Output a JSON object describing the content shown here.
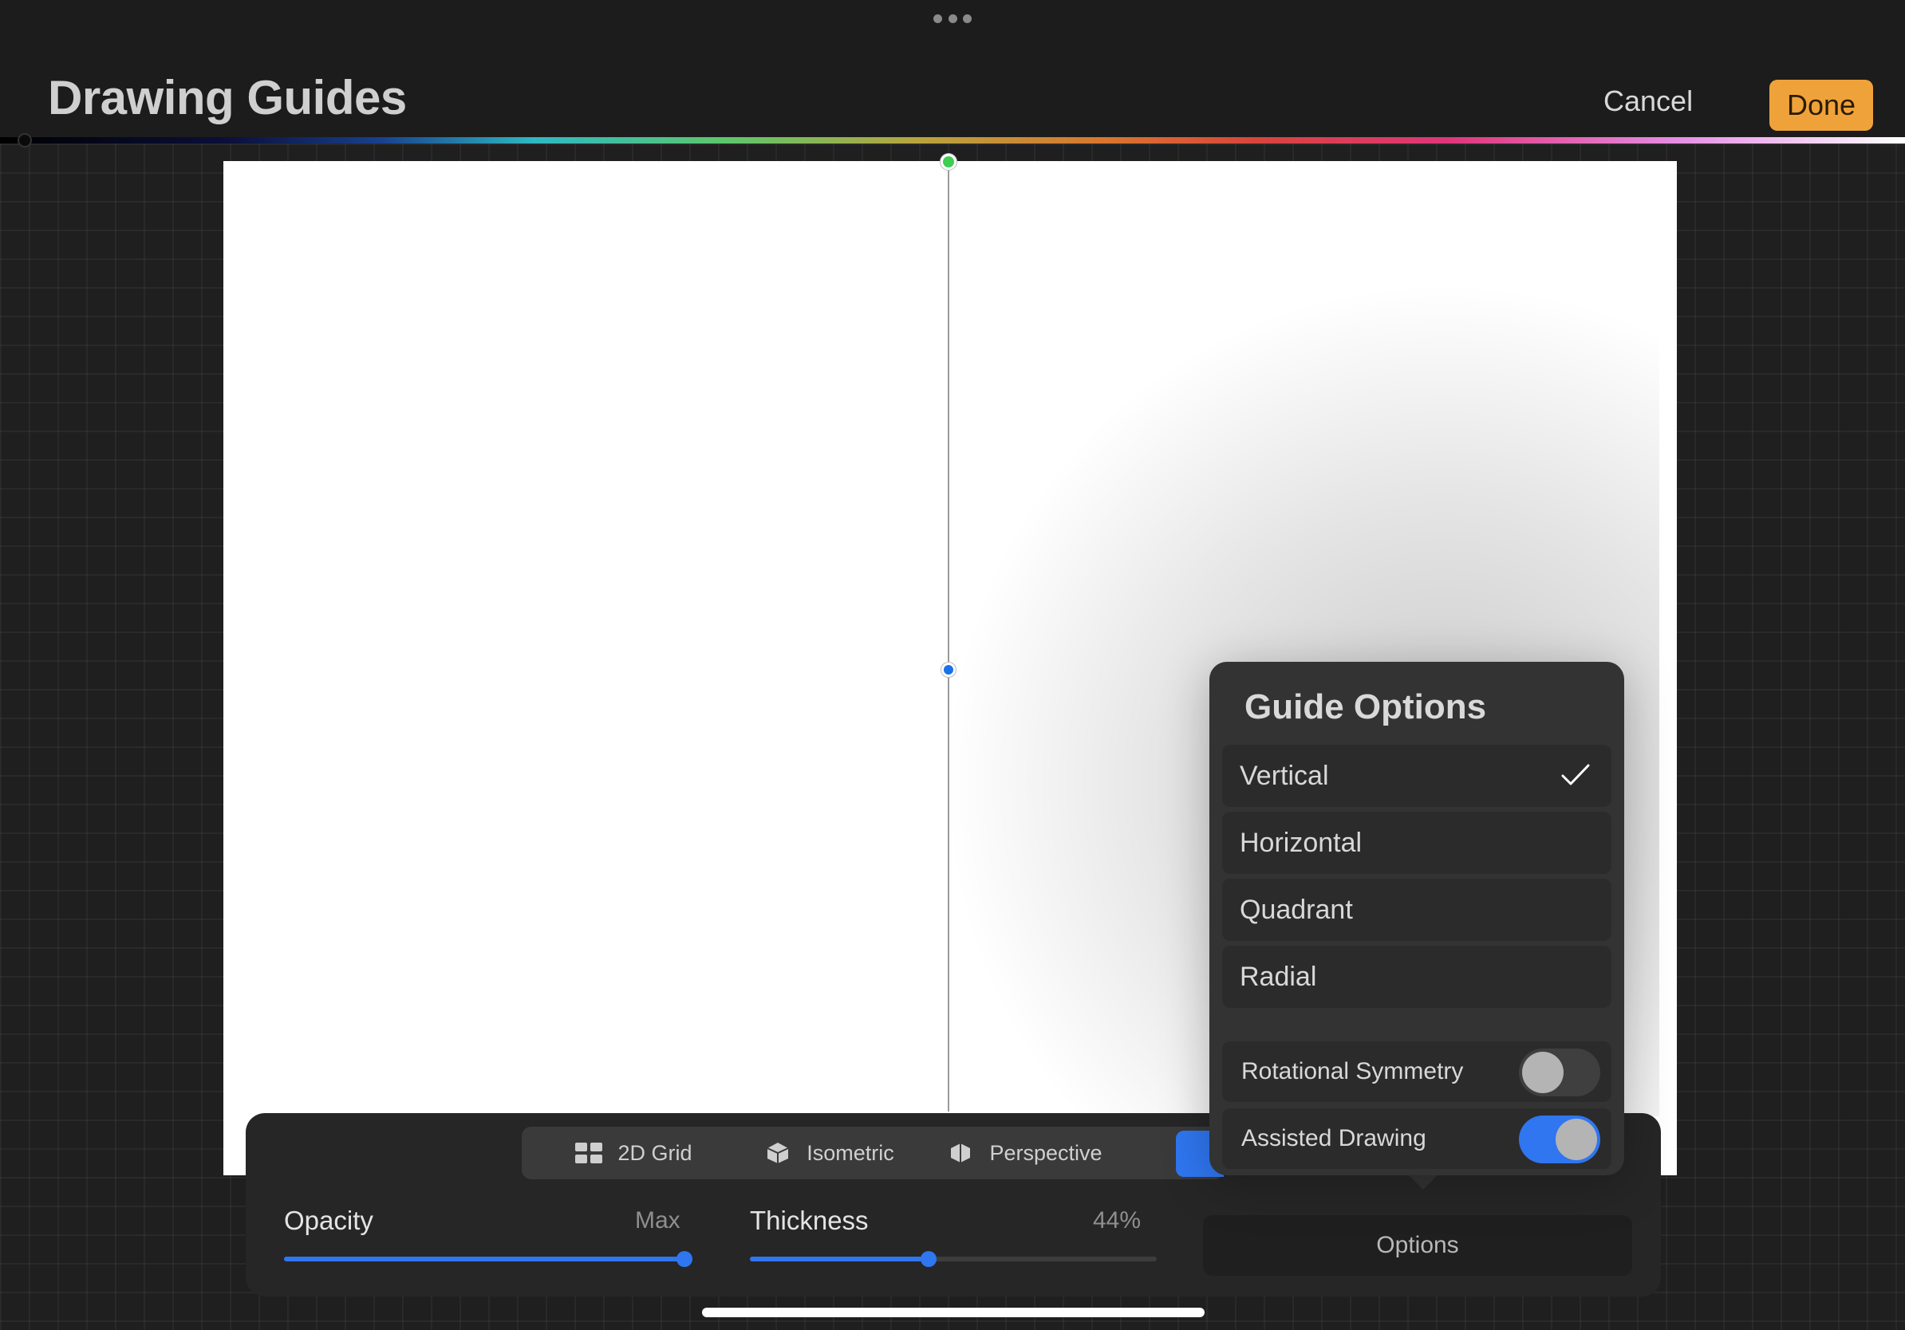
{
  "header": {
    "title": "Drawing Guides",
    "cancel_label": "Cancel",
    "done_label": "Done"
  },
  "guide_tabs": {
    "items": [
      {
        "label": "2D Grid",
        "icon": "grid-icon"
      },
      {
        "label": "Isometric",
        "icon": "cube-icon"
      },
      {
        "label": "Perspective",
        "icon": "hexagon-icon"
      }
    ]
  },
  "sliders": {
    "opacity": {
      "label": "Opacity",
      "value_text": "Max",
      "fraction": 1.0
    },
    "thickness": {
      "label": "Thickness",
      "value_text": "44%",
      "fraction": 0.44
    }
  },
  "options_label": "Options",
  "guide_options": {
    "title": "Guide Options",
    "items": [
      {
        "label": "Vertical",
        "selected": true
      },
      {
        "label": "Horizontal",
        "selected": false
      },
      {
        "label": "Quadrant",
        "selected": false
      },
      {
        "label": "Radial",
        "selected": false
      }
    ],
    "toggles": [
      {
        "label": "Rotational Symmetry",
        "on": false
      },
      {
        "label": "Assisted Drawing",
        "on": true
      }
    ]
  },
  "colors": {
    "accent": "#2f76f0",
    "done": "#f0a23a",
    "top_node": "#3ccf52",
    "center_node": "#1a72e8"
  }
}
